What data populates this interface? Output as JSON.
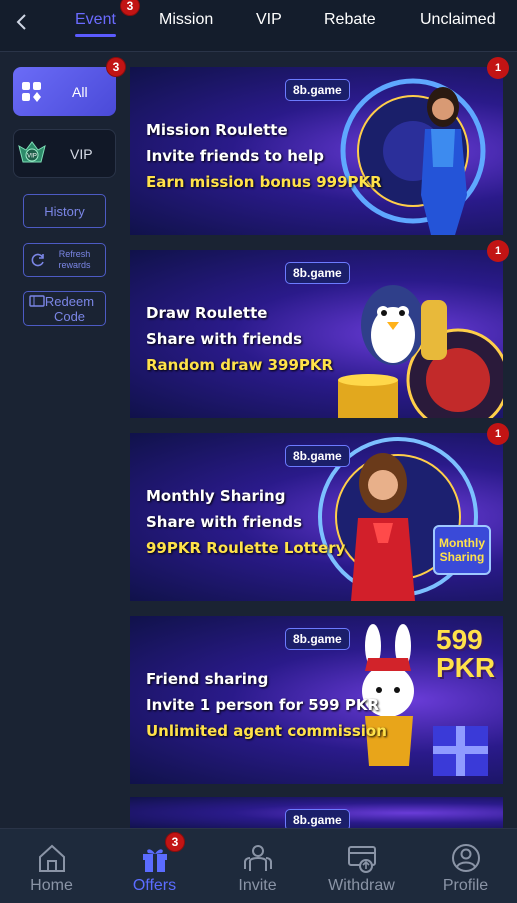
{
  "header": {
    "tabs": [
      {
        "label": "Event",
        "badge": "3"
      },
      {
        "label": "Mission"
      },
      {
        "label": "VIP"
      },
      {
        "label": "Rebate"
      },
      {
        "label": "Unclaimed"
      }
    ],
    "active_tab": "Event"
  },
  "sidebar": {
    "all_label": "All",
    "all_badge": "3",
    "vip_label": "VIP",
    "vip_icon_text": "VIP",
    "history_label": "History",
    "refresh_label": "Refresh rewards",
    "redeem_label": "Redeem Code"
  },
  "banners": [
    {
      "logo": "8b.game",
      "line1": "Mission Roulette",
      "line2": "Invite friends to help",
      "line3": "Earn mission bonus 999PKR",
      "badge": "1"
    },
    {
      "logo": "8b.game",
      "line1": "Draw Roulette",
      "line2": "Share with friends",
      "line3": "Random draw 399PKR",
      "badge": "1"
    },
    {
      "logo": "8b.game",
      "line1": "Monthly Sharing",
      "line2": "Share with friends",
      "line3": "99PKR Roulette Lottery",
      "badge": "1",
      "tag": "Monthly Sharing"
    },
    {
      "logo": "8b.game",
      "line1": "Friend sharing",
      "line2": "Invite 1 person for 599 PKR",
      "line3": "Unlimited agent commission",
      "amount": "599",
      "currency": "PKR"
    },
    {
      "logo": "8b.game"
    }
  ],
  "bottom_nav": [
    {
      "label": "Home"
    },
    {
      "label": "Offers",
      "badge": "3"
    },
    {
      "label": "Invite"
    },
    {
      "label": "Withdraw"
    },
    {
      "label": "Profile"
    }
  ],
  "colors": {
    "accent": "#5b5bff",
    "badge": "#c21414",
    "highlight_text": "#ffe24a",
    "background": "#1a2333"
  }
}
